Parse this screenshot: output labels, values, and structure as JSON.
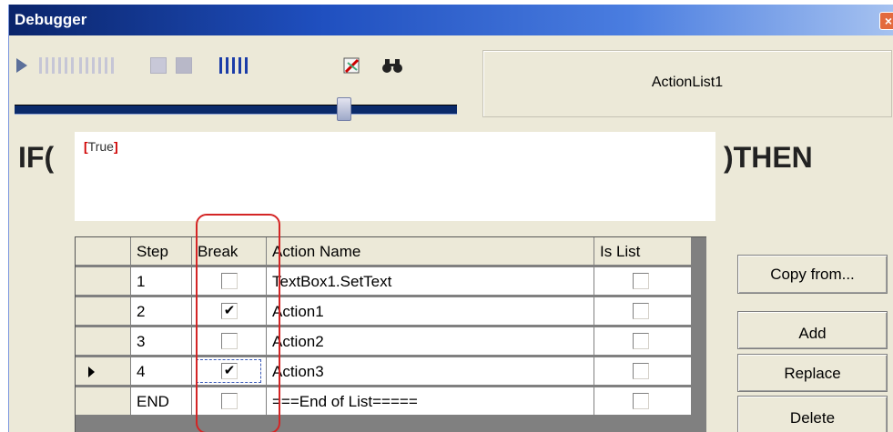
{
  "window": {
    "title": "Debugger",
    "close_glyph": "×"
  },
  "toolbar": {
    "icons": [
      "play-icon",
      "step-icon",
      "step-over-icon",
      "stop-icon",
      "breakpoints-icon",
      "clear-icon",
      "find-icon"
    ]
  },
  "action_list": {
    "name": "ActionList1"
  },
  "condition": {
    "if_label": "IF(",
    "then_label": ")THEN",
    "open_bracket": "[",
    "value": "True",
    "close_bracket": "]"
  },
  "grid": {
    "columns": [
      "Step",
      "Break",
      "Action Name",
      "Is List"
    ],
    "rows": [
      {
        "step": "1",
        "break": "",
        "action": "TextBox1.SetText",
        "is_list": "",
        "current": false
      },
      {
        "step": "2",
        "break": "✔",
        "action": "Action1",
        "is_list": "",
        "current": false
      },
      {
        "step": "3",
        "break": "",
        "action": "Action2",
        "is_list": "",
        "current": false
      },
      {
        "step": "4",
        "break": "✔",
        "action": "Action3",
        "is_list": "",
        "current": true
      },
      {
        "step": "END",
        "break": "",
        "action": "===End of List=====",
        "is_list": "",
        "current": false
      }
    ]
  },
  "buttons": {
    "copy_from": "Copy from...",
    "add": "Add",
    "replace": "Replace",
    "delete": "Delete"
  },
  "colors": {
    "accent": "#1f4fbf",
    "highlight": "#d42525"
  }
}
